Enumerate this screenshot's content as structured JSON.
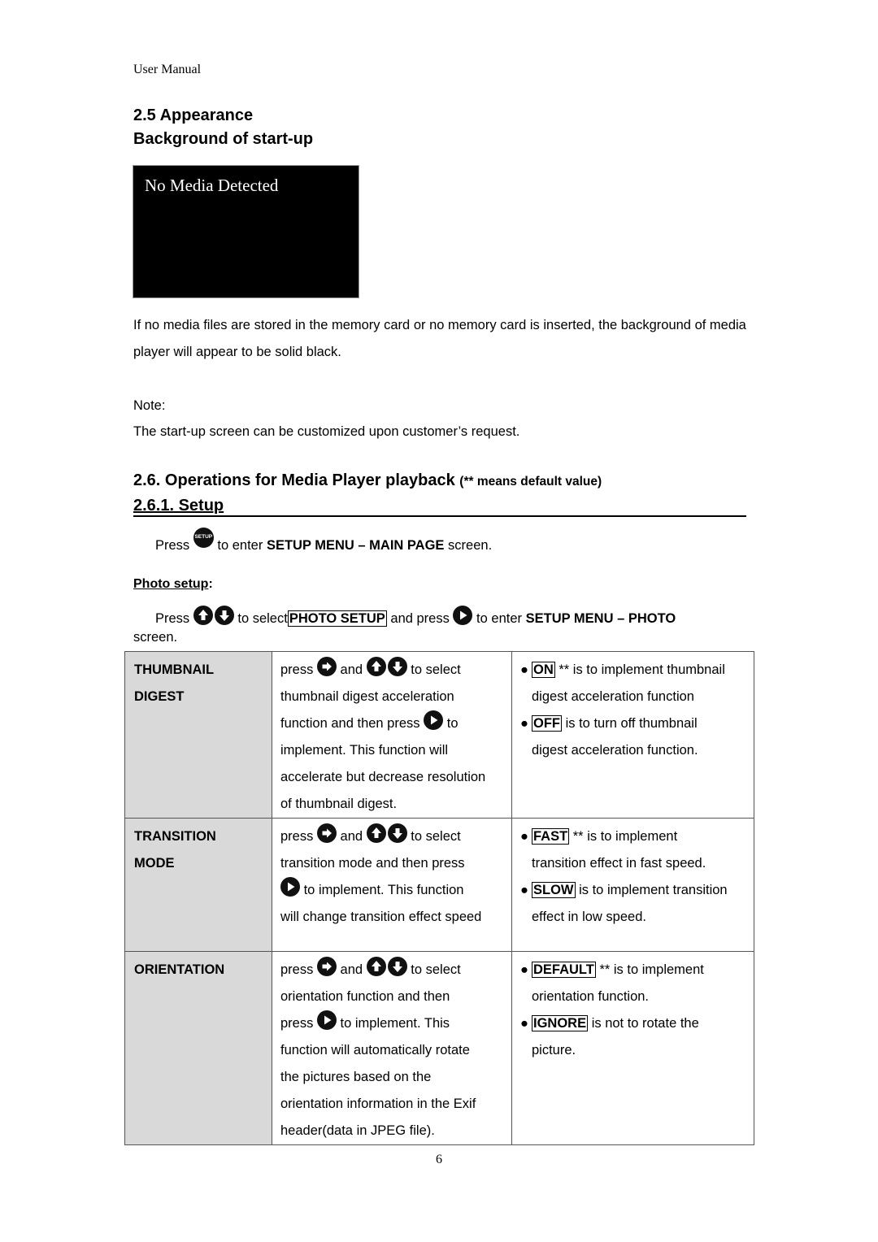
{
  "header": {
    "running_head": "User Manual"
  },
  "section_2_5": {
    "title": "2.5 Appearance",
    "subtitle": "Background of start-up",
    "screen_text": "No Media Detected",
    "paragraph": "If no media files are stored in the memory card or no memory card is inserted, the background of media player will appear to be solid black.",
    "note_label": "Note:",
    "note_text": "The start-up screen can be customized upon customer’s request."
  },
  "section_2_6": {
    "title": "2.6. Operations for Media Player playback",
    "title_note": "(** means default value)",
    "sub_title": "2.6.1. Setup",
    "setup_line": {
      "press": "Press",
      "icon": "setup-button-icon",
      "icon_label": "SETUP",
      "to_enter": "to enter",
      "target": "SETUP MENU – MAIN PAGE",
      "suffix": "screen."
    },
    "photo_setup_label": "Photo setup",
    "photo_setup_colon": ":",
    "photo_line": {
      "press": "Press",
      "to_select": "to select",
      "selected": "PHOTO SETUP",
      "and_press": "and press",
      "to_enter": "to enter",
      "target": "SETUP MENU – PHOTO",
      "suffix": "screen."
    }
  },
  "table": {
    "rows": [
      {
        "name_line1": "THUMBNAIL",
        "name_line2": "DIGEST",
        "desc": {
          "l1a": "press",
          "l1b": "and",
          "l1c": "to select",
          "l2": "thumbnail digest acceleration",
          "l3a": "function and then press",
          "l3b": "to",
          "l4": "implement. This function will",
          "l5": "accelerate but decrease resolution",
          "l6": "of thumbnail digest."
        },
        "options": [
          {
            "value": "ON",
            "default_mark": "**",
            "text": "is to implement thumbnail",
            "cont": "digest acceleration function"
          },
          {
            "value": "OFF",
            "default_mark": "",
            "text": "is to turn off thumbnail",
            "cont": "digest acceleration function."
          }
        ]
      },
      {
        "name_line1": "TRANSITION",
        "name_line2": "MODE",
        "desc": {
          "l1a": "press",
          "l1b": "and",
          "l1c": "to select",
          "l2": "transition mode and then press",
          "l3": "to implement. This function",
          "l4": "will change transition effect speed"
        },
        "options": [
          {
            "value": "FAST",
            "default_mark": "**",
            "text": "is to implement",
            "cont": "transition effect in fast speed."
          },
          {
            "value": "SLOW",
            "default_mark": "",
            "text": "is to implement transition",
            "cont": "effect in low speed."
          }
        ]
      },
      {
        "name_line1": "ORIENTATION",
        "desc": {
          "l1a": "press",
          "l1b": "and",
          "l1c": "to select",
          "l2": "orientation function and then",
          "l3a": "press",
          "l3b": "to implement. This",
          "l4": "function will automatically rotate",
          "l5": "the pictures based on the",
          "l6": "orientation information in the Exif",
          "l7": "header(data in JPEG file)."
        },
        "options": [
          {
            "value": "DEFAULT",
            "default_mark": "**",
            "text": "is to implement",
            "cont": "orientation function."
          },
          {
            "value": "IGNORE",
            "default_mark": "",
            "text": "is not to rotate the",
            "cont": "picture."
          }
        ]
      }
    ]
  },
  "footer": {
    "page_number": "6"
  }
}
